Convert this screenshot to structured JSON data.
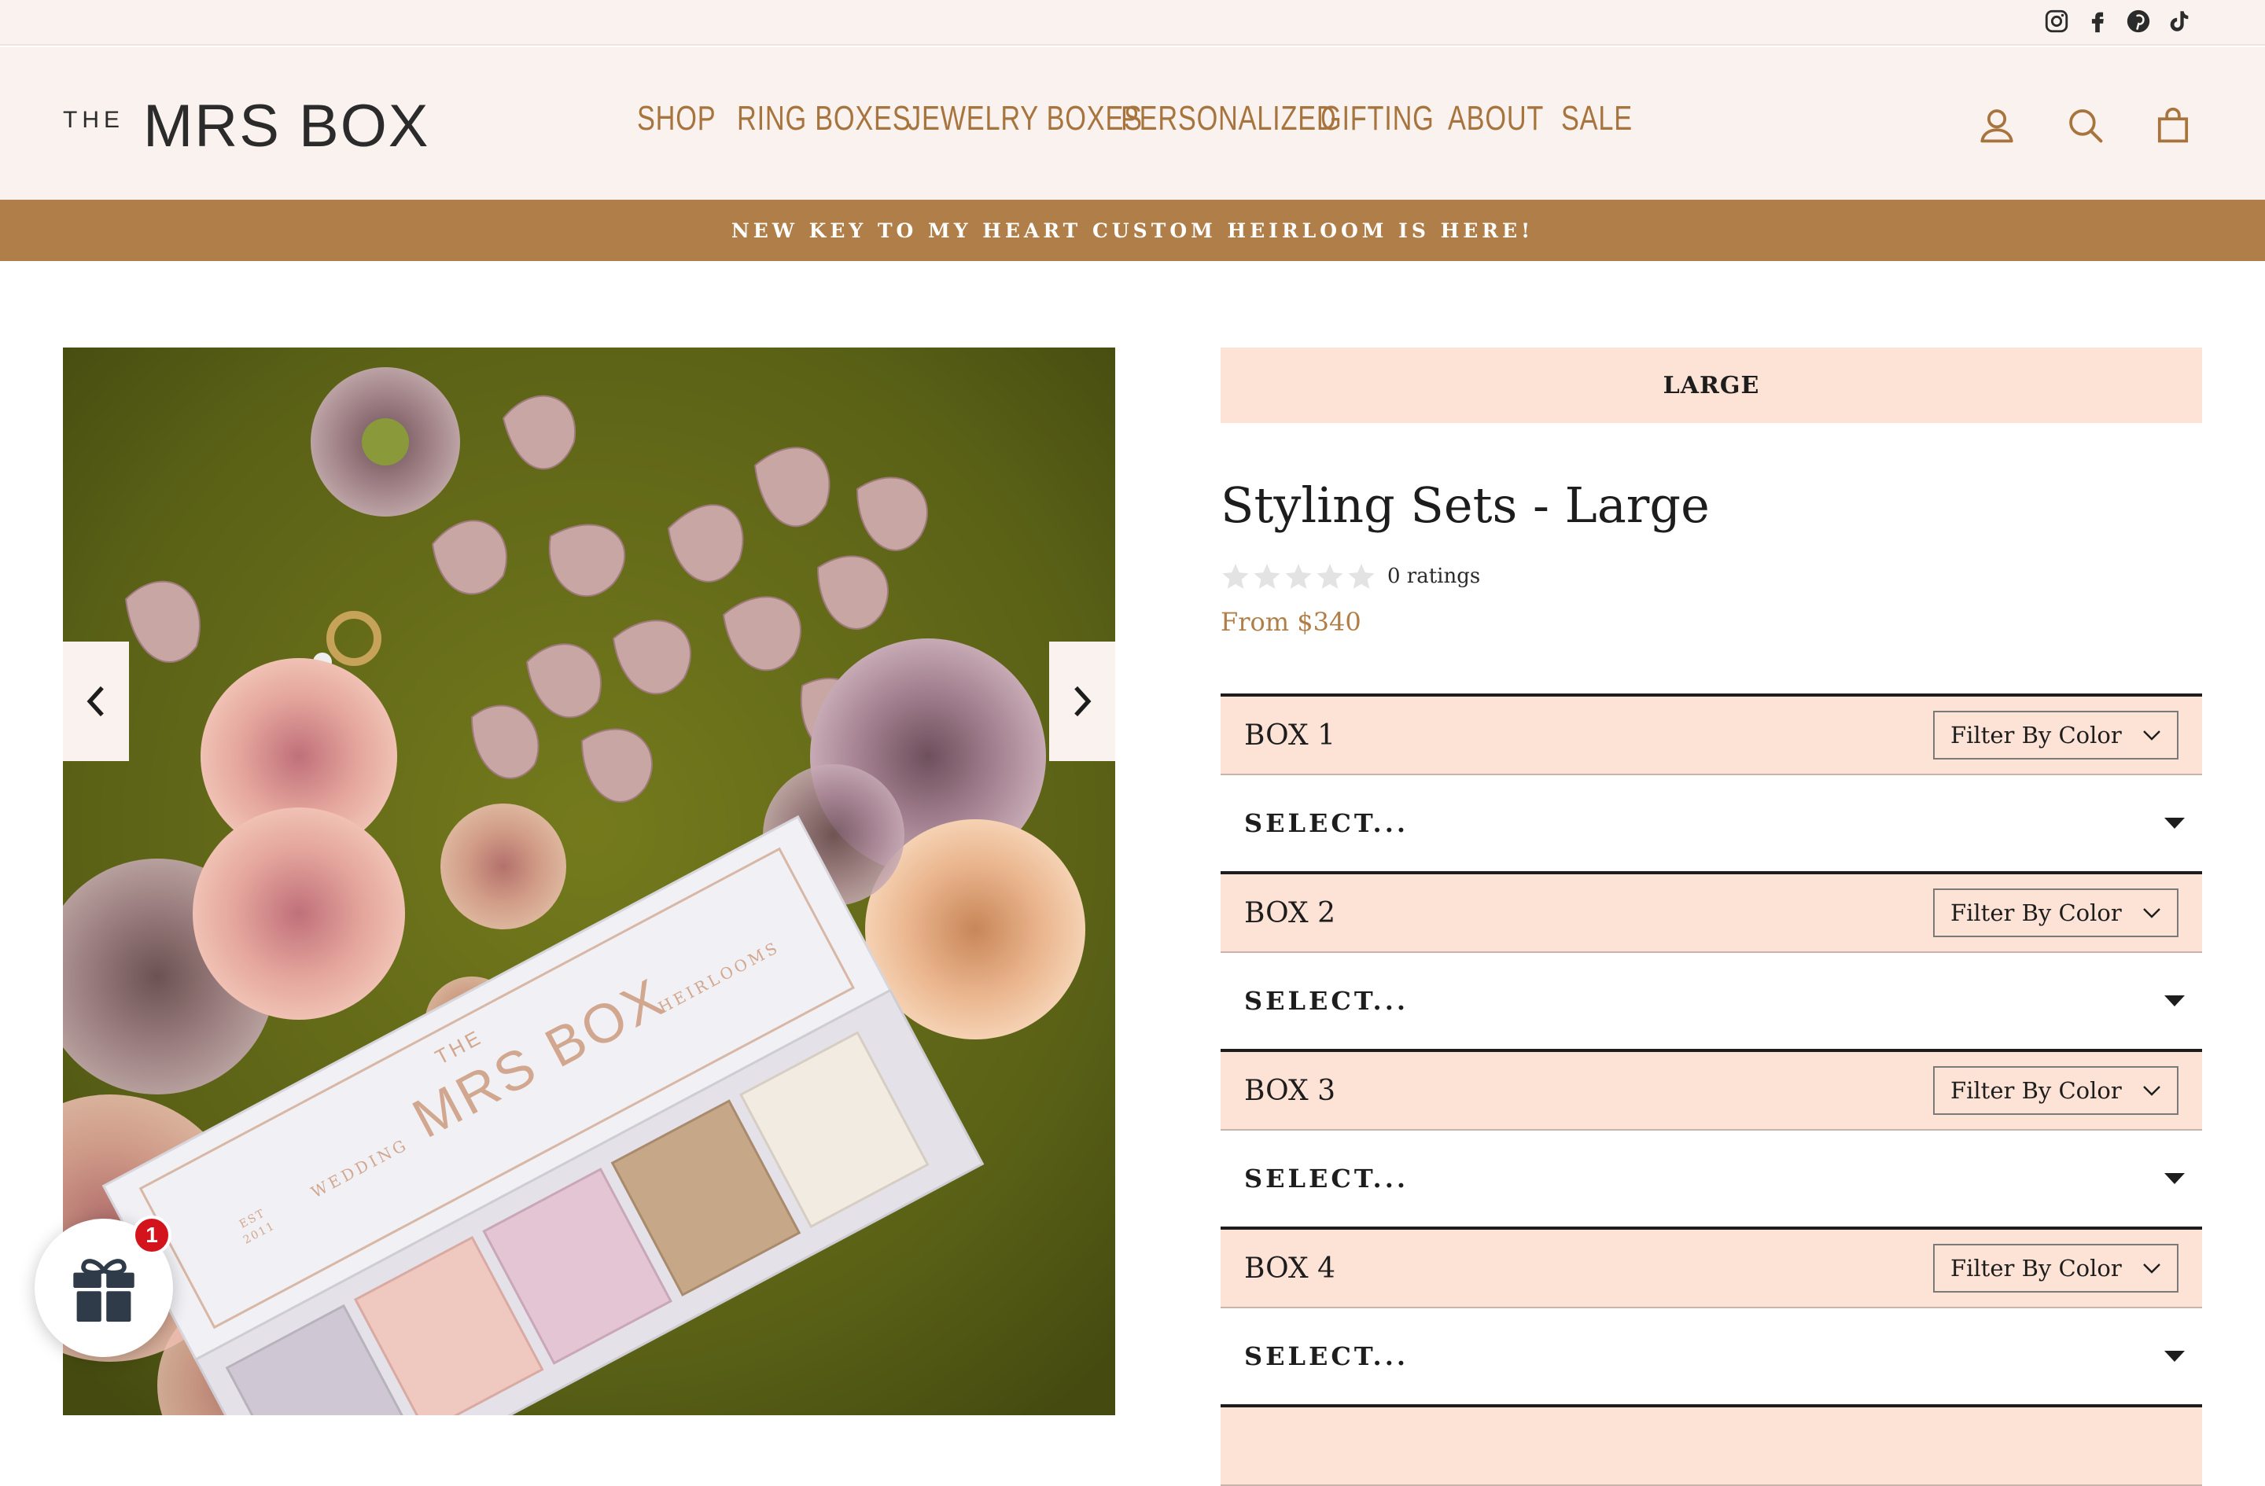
{
  "social": {
    "icons": [
      "instagram-icon",
      "facebook-icon",
      "pinterest-icon",
      "tiktok-icon"
    ]
  },
  "header": {
    "logo_small": "THE",
    "logo_main": "MRS BOX",
    "nav": [
      "SHOP",
      "RING BOXES",
      "JEWELRY BOXES",
      "PERSONALIZED",
      "GIFTING",
      "ABOUT",
      "SALE"
    ],
    "icons": [
      "account-icon",
      "search-icon",
      "cart-icon"
    ]
  },
  "announcement": "NEW KEY TO MY HEART CUSTOM HEIRLOOM IS HERE!",
  "gallery": {
    "box_text_the": "THE",
    "box_text_brand": "MRS BOX",
    "box_text_wedding": "WEDDING",
    "box_text_heirlooms": "HEIRLOOMS",
    "box_text_est": "EST",
    "box_text_year": "2011"
  },
  "product": {
    "variant": "LARGE",
    "title": "Styling Sets - Large",
    "rating_count": "0 ratings",
    "rating_value": 0,
    "price": "From $340",
    "boxes": [
      {
        "label": "BOX 1",
        "filter": "Filter By Color",
        "select": "SELECT..."
      },
      {
        "label": "BOX 2",
        "filter": "Filter By Color",
        "select": "SELECT..."
      },
      {
        "label": "BOX 3",
        "filter": "Filter By Color",
        "select": "SELECT..."
      },
      {
        "label": "BOX 4",
        "filter": "Filter By Color",
        "select": "SELECT..."
      }
    ]
  },
  "gift_widget": {
    "badge": "1"
  },
  "colors": {
    "accent": "#b07e48",
    "header_bg": "#faf2ee",
    "panel_bg": "#fde2d6",
    "badge": "#d4141c"
  }
}
